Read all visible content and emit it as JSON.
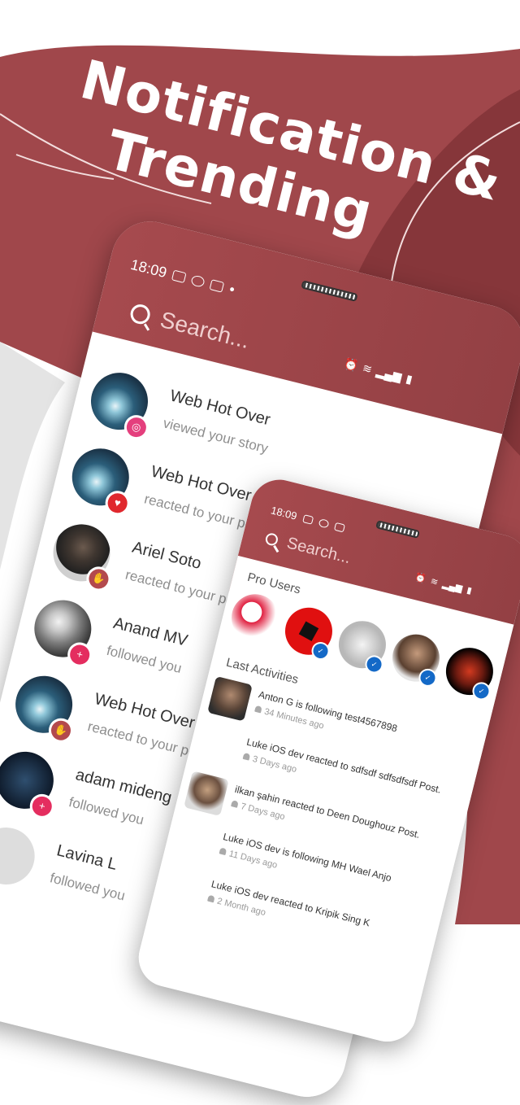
{
  "promo": {
    "line1": "Notification &",
    "line2": "Trending"
  },
  "colors": {
    "brand": "#9c4448",
    "badge_blue": "#1469c7"
  },
  "phone_main": {
    "status_time": "18:09",
    "search_placeholder": "Search...",
    "notifications": [
      {
        "name": "Web Hot Over",
        "action": "viewed your story",
        "badge": "story-icon"
      },
      {
        "name": "Web Hot Over",
        "action": "reacted to your post",
        "badge": "heart-icon"
      },
      {
        "name": "Ariel Soto",
        "action": "reacted to your post",
        "badge": "thumbs-up-icon"
      },
      {
        "name": "Anand MV",
        "action": "followed you",
        "badge": "follow-icon"
      },
      {
        "name": "Web Hot Over",
        "action": "reacted to your post",
        "badge": "thumbs-up-icon"
      },
      {
        "name": "adam mideng",
        "action": "followed you",
        "badge": "follow-icon"
      },
      {
        "name": "Lavina L",
        "action": "followed you",
        "badge": "follow-icon"
      }
    ]
  },
  "phone_second": {
    "status_time": "18:09",
    "search_placeholder": "Search...",
    "pro_users_title": "Pro Users",
    "last_activities_title": "Last Activities",
    "activities": [
      {
        "text": "Anton G is following test4567898",
        "time": "34 Minutes ago"
      },
      {
        "text": "Luke iOS dev reacted to sdfsdf sdfsdfsdf Post.",
        "time": "3 Days ago"
      },
      {
        "text": "ilkan şahin reacted to Deen Doughouz Post.",
        "time": "7 Days ago"
      },
      {
        "text": "Luke iOS dev is following MH Wael Anjo",
        "time": "11 Days ago"
      },
      {
        "text": "Luke iOS dev reacted to Kripik Sing K",
        "time": "2 Month ago"
      }
    ]
  }
}
